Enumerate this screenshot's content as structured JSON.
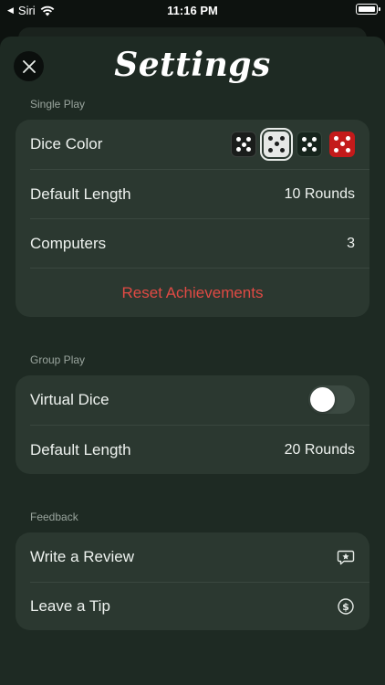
{
  "status": {
    "back": "Siri",
    "time": "11:16 PM"
  },
  "title": "Settings",
  "sections": {
    "single_play": {
      "label": "Single Play",
      "dice_color_label": "Dice Color",
      "dice_colors": [
        "black",
        "white",
        "dark-green",
        "red"
      ],
      "selected_dice": "white",
      "default_length_label": "Default Length",
      "default_length_value": "10 Rounds",
      "computers_label": "Computers",
      "computers_value": "3",
      "reset_label": "Reset Achievements"
    },
    "group_play": {
      "label": "Group Play",
      "virtual_dice_label": "Virtual Dice",
      "virtual_dice_on": false,
      "default_length_label": "Default Length",
      "default_length_value": "20 Rounds"
    },
    "feedback": {
      "label": "Feedback",
      "review_label": "Write a Review",
      "review_icon": "star-bubble-icon",
      "tip_label": "Leave a Tip",
      "tip_icon": "dollar-circle-icon"
    }
  },
  "colors": {
    "background": "#1e2a23",
    "card": "#2b3830",
    "destructive": "#e04a44",
    "die_red": "#c41a1a"
  }
}
